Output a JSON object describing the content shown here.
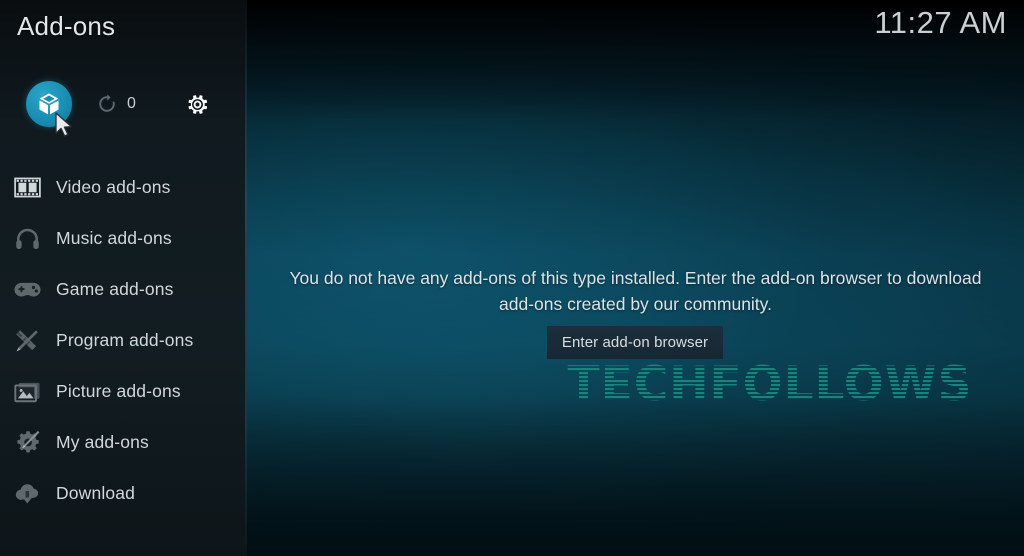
{
  "window": {
    "title": "Add-ons",
    "clock": "11:27 AM"
  },
  "toolbar": {
    "addon_browser_icon": "open-box-icon",
    "refresh_icon": "refresh-icon",
    "update_count": "0",
    "settings_icon": "gear-icon",
    "accent_color": "#1a8db3"
  },
  "sidebar": {
    "items": [
      {
        "label": "Video add-ons",
        "icon": "film-strip-icon"
      },
      {
        "label": "Music add-ons",
        "icon": "headphones-icon"
      },
      {
        "label": "Game add-ons",
        "icon": "gamepad-icon"
      },
      {
        "label": "Program add-ons",
        "icon": "pencil-ruler-icon"
      },
      {
        "label": "Picture add-ons",
        "icon": "photo-icon"
      },
      {
        "label": "My add-ons",
        "icon": "gear-screwdriver-icon"
      },
      {
        "label": "Download",
        "icon": "cloud-download-icon"
      }
    ]
  },
  "main": {
    "empty_message": "You do not have any add-ons of this type installed. Enter the add-on browser to download add-ons created by our community.",
    "browse_button_label": "Enter add-on browser",
    "watermark_text": "TECHFOLLOWS",
    "watermark_color": "#17897f"
  },
  "cursor": {
    "icon": "mouse-pointer-icon"
  }
}
